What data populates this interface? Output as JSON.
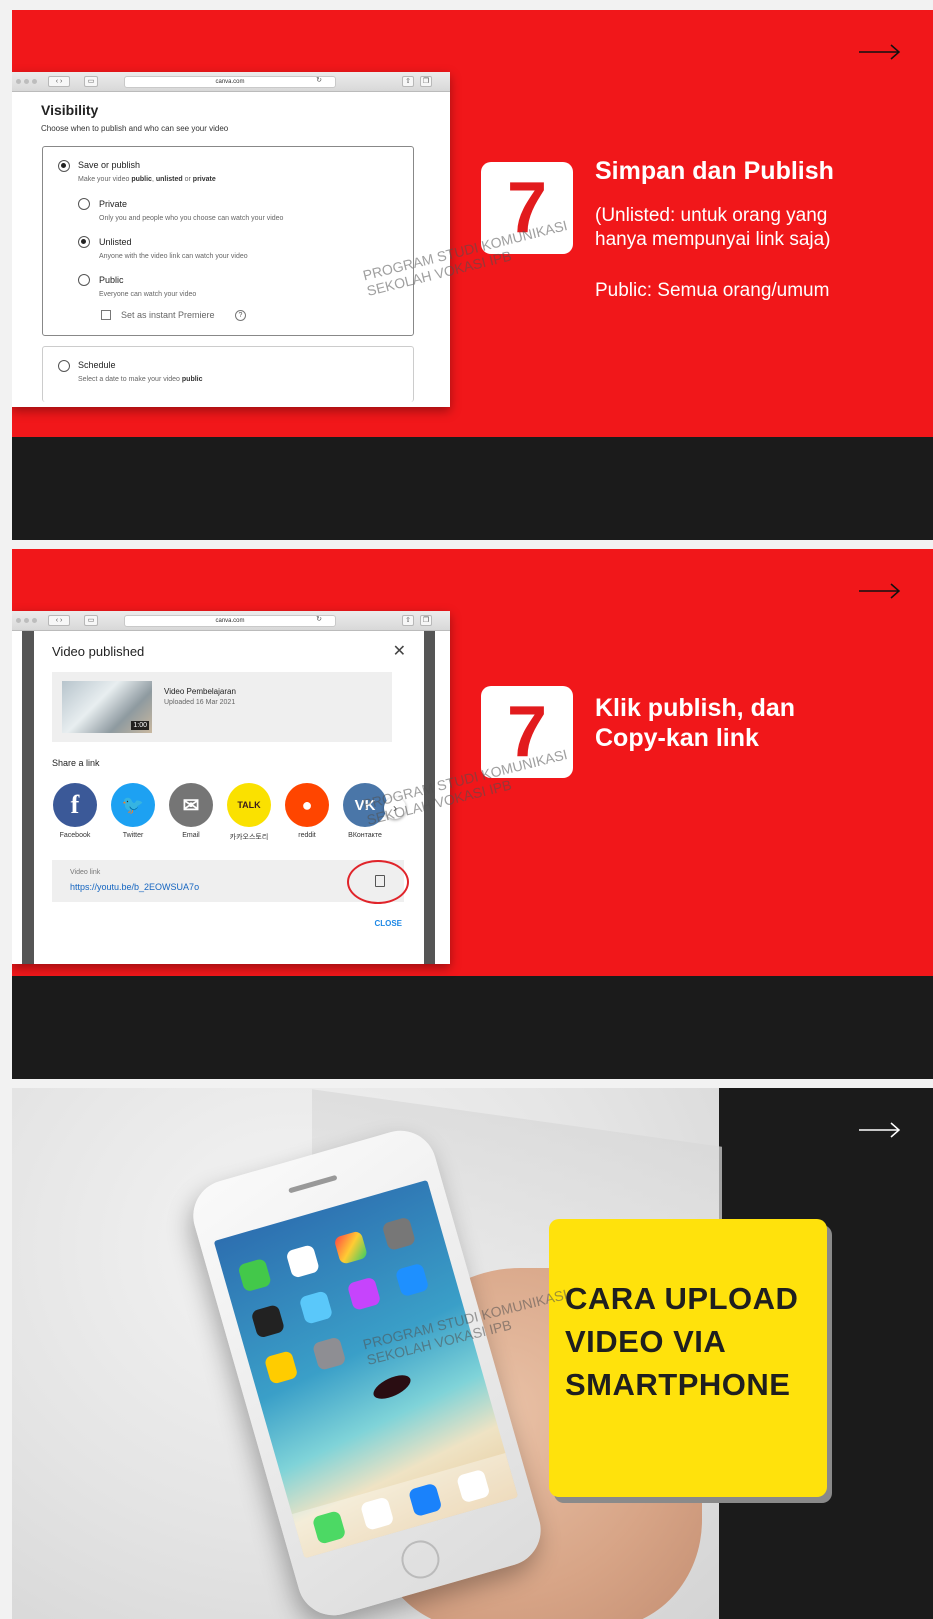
{
  "watermark": {
    "line1": "PROGRAM STUDI KOMUNIKASI",
    "line2": "SEKOLAH VOKASI IPB"
  },
  "slide1": {
    "browser_url": "canva.com",
    "visibility": {
      "title": "Visibility",
      "subtitle": "Choose when to publish and who can see your video",
      "save_or_publish": {
        "label": "Save or publish",
        "desc_pre": "Make your video ",
        "desc_public": "public",
        "desc_sep": ", ",
        "desc_unlisted": "unlisted",
        "desc_or": " or ",
        "desc_private": "private"
      },
      "private": {
        "label": "Private",
        "desc": "Only you and people who you choose can watch your video"
      },
      "unlisted": {
        "label": "Unlisted",
        "desc": "Anyone with the video link can watch your video"
      },
      "public": {
        "label": "Public",
        "desc": "Everyone can watch your video"
      },
      "premiere": {
        "label": "Set as instant Premiere"
      },
      "schedule": {
        "label": "Schedule",
        "desc_pre": "Select a date to make your video ",
        "desc_bold": "public"
      }
    },
    "step_number": "7",
    "heading": "Simpan dan Publish",
    "body_line1": "(Unlisted: untuk orang yang",
    "body_line2": "hanya mempunyai link saja)",
    "body_line3": "Public: Semua orang/umum"
  },
  "slide2": {
    "browser_url": "canva.com",
    "modal": {
      "title": "Video published",
      "close_glyph": "✕",
      "video_title": "Video Pembelajaran",
      "video_date": "Uploaded 16 Mar 2021",
      "duration": "1:00",
      "share_label": "Share a link",
      "share_targets": [
        {
          "name": "Facebook",
          "glyph": "f",
          "color": "#3b5998"
        },
        {
          "name": "Twitter",
          "glyph": "🐦",
          "color": "#1da1f2"
        },
        {
          "name": "Email",
          "glyph": "✉",
          "color": "#757575"
        },
        {
          "name": "카카오스토리",
          "glyph": "TALK",
          "color": "#fae100"
        },
        {
          "name": "reddit",
          "glyph": "●",
          "color": "#ff4500"
        },
        {
          "name": "ВКонтакте",
          "glyph": "VK",
          "color": "#4a76a8"
        }
      ],
      "next_glyph": "›",
      "link_label": "Video link",
      "link_value": "https://youtu.be/b_2EOWSUA7o",
      "close_link": "CLOSE"
    },
    "step_number": "7",
    "heading_line1": "Klik publish, dan",
    "heading_line2": "Copy-kan link"
  },
  "slide3": {
    "title_line1": "CARA UPLOAD",
    "title_line2": "VIDEO VIA",
    "title_line3": "SMARTPHONE",
    "accent_color": "#ffe20c"
  },
  "colors": {
    "slide_red": "#f1171a",
    "slide_dark": "#1b1b1b",
    "badge_number": "#e21b1d"
  }
}
